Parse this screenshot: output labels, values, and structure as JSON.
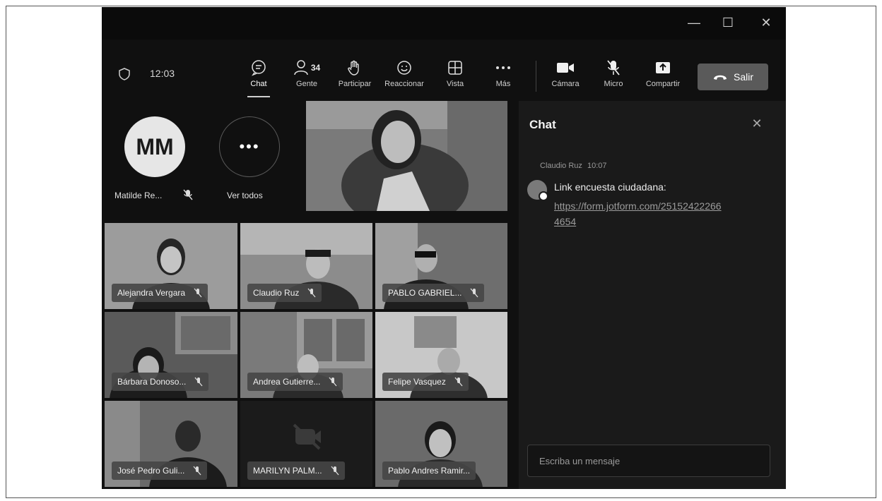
{
  "toolbar": {
    "time": "12:03",
    "chat_label": "Chat",
    "people_label": "Gente",
    "people_count": "34",
    "raise_label": "Participar",
    "react_label": "Reaccionar",
    "view_label": "Vista",
    "more_label": "Más",
    "camera_label": "Cámara",
    "mic_label": "Micro",
    "share_label": "Compartir",
    "leave_label": "Salir"
  },
  "roster": {
    "avatar_initials": "MM",
    "avatar_name": "Matilde Re...",
    "see_all_label": "Ver todos"
  },
  "participants": [
    {
      "name": "Alejandra Vergara"
    },
    {
      "name": "Claudio Ruz"
    },
    {
      "name": "PABLO GABRIEL..."
    },
    {
      "name": "Bárbara Donoso..."
    },
    {
      "name": "Andrea Gutierre..."
    },
    {
      "name": "Felipe Vasquez"
    },
    {
      "name": "José Pedro Guli..."
    },
    {
      "name": "MARILYN PALM..."
    },
    {
      "name": "Pablo Andres Ramir..."
    }
  ],
  "chat": {
    "title": "Chat",
    "message_author": "Claudio Ruz",
    "message_time": "10:07",
    "message_text": "Link encuesta ciudadana:",
    "message_link": "https://form.jotform.com/251524222664654",
    "input_placeholder": "Escriba un mensaje"
  },
  "colors": {
    "window_bg": "#101010",
    "chat_bg": "#1a1a1a",
    "leave_button": "#5a5a5a"
  }
}
